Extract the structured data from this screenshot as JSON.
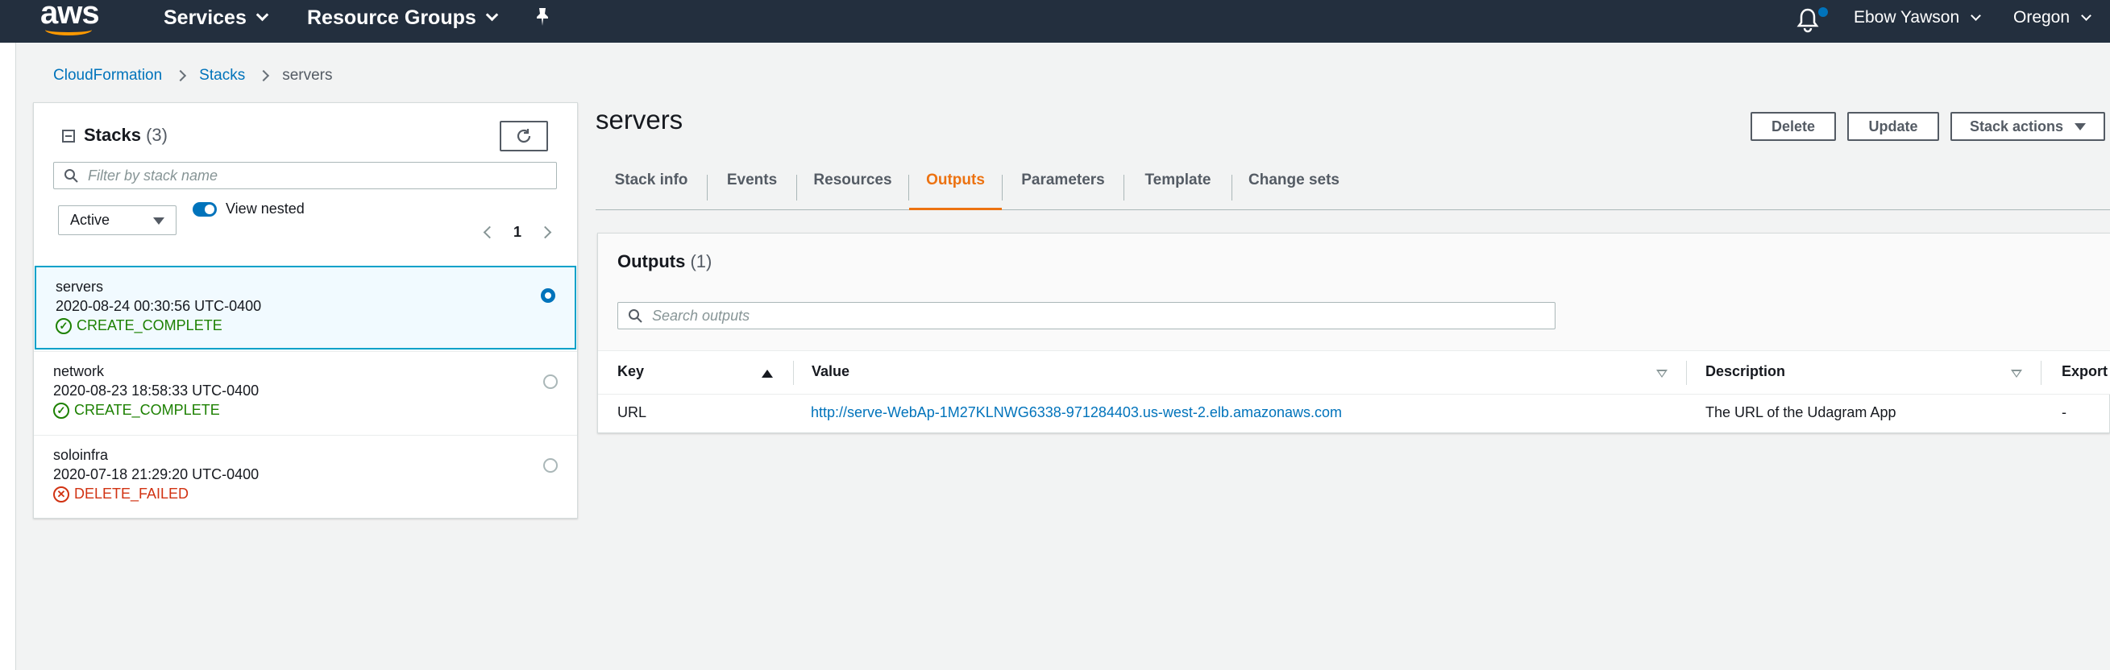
{
  "nav": {
    "logo": "aws",
    "services": "Services",
    "resource_groups": "Resource Groups",
    "user": "Ebow Yawson",
    "region": "Oregon"
  },
  "breadcrumb": [
    "CloudFormation",
    "Stacks",
    "servers"
  ],
  "stacks_panel": {
    "title": "Stacks",
    "count": "(3)",
    "filter_placeholder": "Filter by stack name",
    "status_filter": "Active",
    "view_nested_label": "View nested",
    "page": "1",
    "stacks": [
      {
        "name": "servers",
        "time": "2020-08-24 00:30:56 UTC-0400",
        "status": "CREATE_COMPLETE",
        "selected": true
      },
      {
        "name": "network",
        "time": "2020-08-23 18:58:33 UTC-0400",
        "status": "CREATE_COMPLETE",
        "selected": false
      },
      {
        "name": "soloinfra",
        "time": "2020-07-18 21:29:20 UTC-0400",
        "status": "DELETE_FAILED",
        "selected": false
      }
    ]
  },
  "detail": {
    "title": "servers",
    "delete_label": "Delete",
    "update_label": "Update",
    "stack_actions_label": "Stack actions",
    "tabs": [
      "Stack info",
      "Events",
      "Resources",
      "Outputs",
      "Parameters",
      "Template",
      "Change sets"
    ],
    "active_tab": "Outputs"
  },
  "outputs": {
    "title": "Outputs",
    "count": "(1)",
    "search_placeholder": "Search outputs",
    "columns": [
      "Key",
      "Value",
      "Description",
      "Export"
    ],
    "rows": [
      {
        "key": "URL",
        "value": "http://serve-WebAp-1M27KLNWG6338-971284403.us-west-2.elb.amazonaws.com",
        "description": "The URL of the Udagram App",
        "export": "-"
      }
    ]
  },
  "colors": {
    "nav_bg": "#232f3e",
    "accent": "#ec7211",
    "link": "#0073bb",
    "success": "#1d8102",
    "error": "#d13212"
  }
}
